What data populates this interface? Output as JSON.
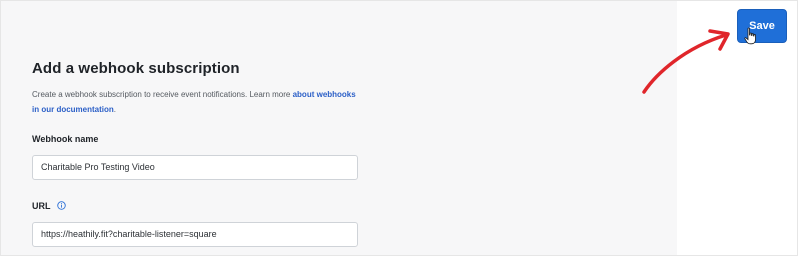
{
  "form": {
    "title": "Add a webhook subscription",
    "description_prefix": "Create a webhook subscription to receive event notifications. Learn more ",
    "description_link": "about webhooks in our documentation",
    "description_suffix": ".",
    "webhook_name_label": "Webhook name",
    "webhook_name_value": "Charitable Pro Testing Video",
    "url_label": "URL",
    "url_value": "https://heathily.fit?charitable-listener=square"
  },
  "toolbar": {
    "save_label": "Save"
  },
  "colors": {
    "accent": "#1f6fd8",
    "link": "#2b5fc7",
    "annotation_arrow": "#e0262b"
  },
  "icons": {
    "help": "info-circle-icon",
    "cursor": "hand-pointer-cursor",
    "annotation": "red-arrow-annotation"
  }
}
